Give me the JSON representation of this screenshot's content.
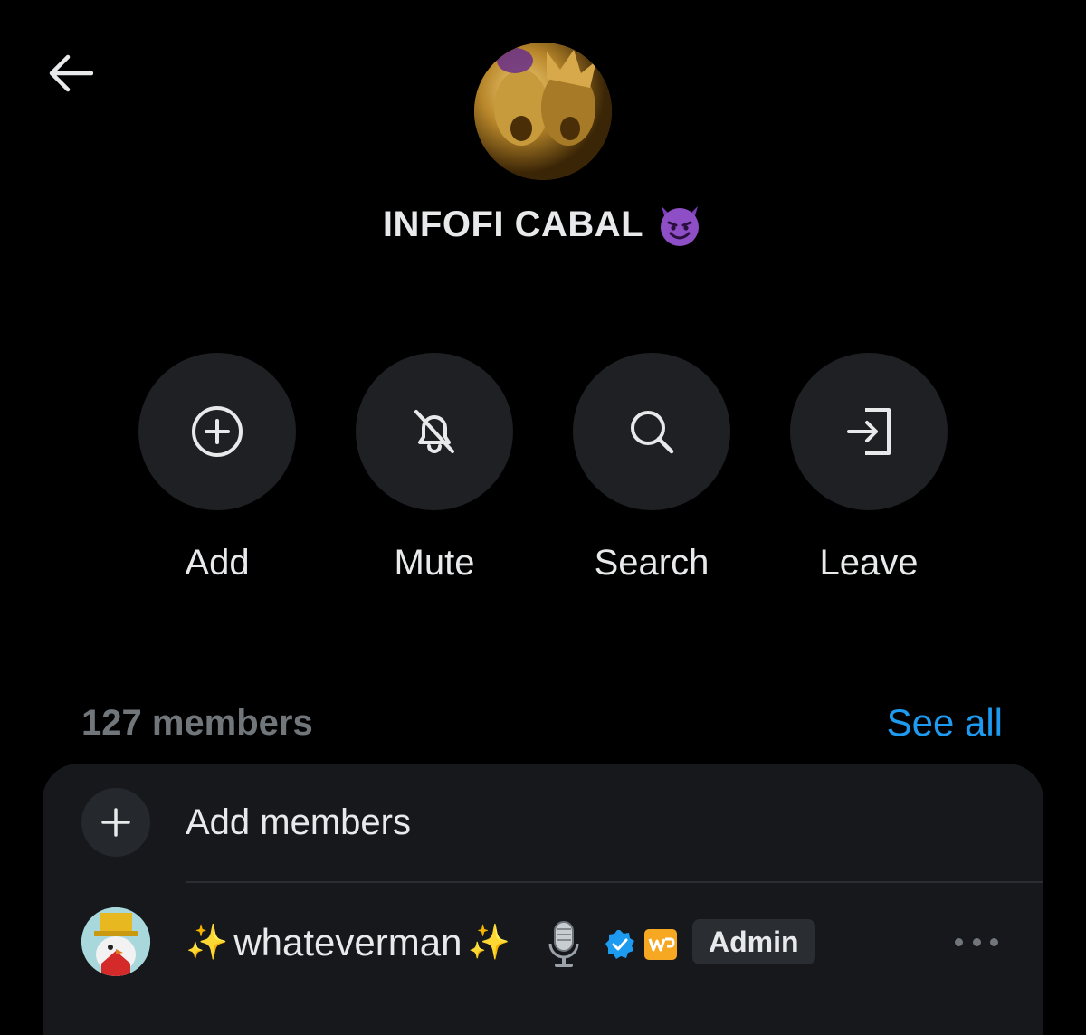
{
  "header": {
    "back_icon": "arrow-left-icon",
    "group_name": "INFOFI CABAL",
    "group_emoji": "smiling-face-with-horns"
  },
  "actions": [
    {
      "label": "Add",
      "icon": "plus-circle-icon"
    },
    {
      "label": "Mute",
      "icon": "bell-off-icon"
    },
    {
      "label": "Search",
      "icon": "search-icon"
    },
    {
      "label": "Leave",
      "icon": "leave-icon"
    }
  ],
  "members": {
    "count_label": "127 members",
    "see_all_label": "See all",
    "add_members_label": "Add members",
    "list": [
      {
        "name": "whateverman",
        "decorations": [
          "✨",
          "✨",
          "🎙️"
        ],
        "verified": true,
        "role_badge": "Admin"
      }
    ]
  },
  "colors": {
    "accent": "#1d9bf0",
    "background": "#000000",
    "card": "#16181c",
    "action_circle": "#1e2023"
  }
}
